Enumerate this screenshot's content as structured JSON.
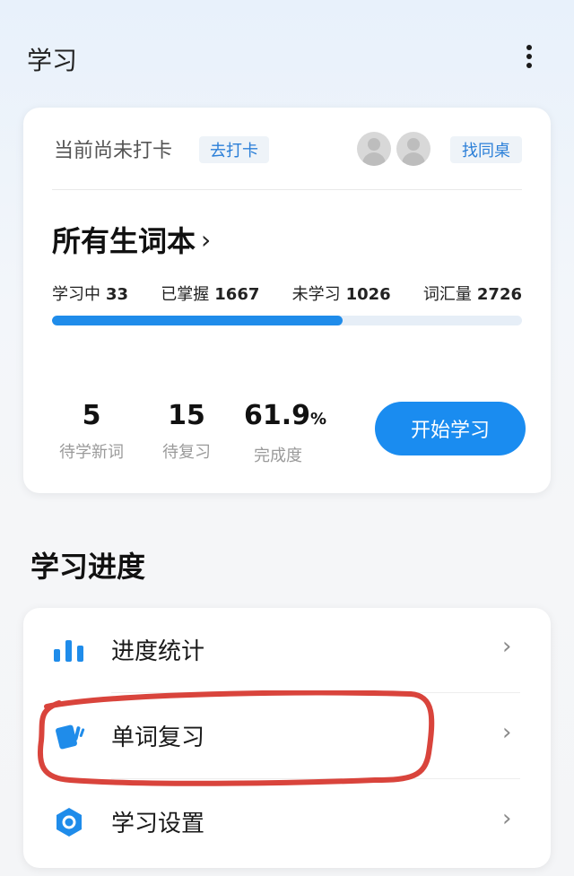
{
  "header": {
    "title": "学习",
    "more_icon": "more-vertical-icon"
  },
  "study_card": {
    "checkin_status": "当前尚未打卡",
    "checkin_button": "去打卡",
    "find_deskmate_button": "找同桌",
    "book_title": "所有生词本",
    "book_chevron": "›",
    "stats": [
      {
        "label": "学习中",
        "value": "33"
      },
      {
        "label": "已掌握",
        "value": "1667"
      },
      {
        "label": "未学习",
        "value": "1026"
      },
      {
        "label": "词汇量",
        "value": "2726"
      }
    ],
    "progress_fraction": 0.619,
    "metrics": [
      {
        "value": "5",
        "label": "待学新词"
      },
      {
        "value": "15",
        "label": "待复习"
      },
      {
        "value": "61.9",
        "unit": "%",
        "label": "完成度"
      }
    ],
    "start_button": "开始学习",
    "accent_color": "#1a8cf0"
  },
  "progress_section": {
    "title": "学习进度",
    "items": [
      {
        "label": "进度统计",
        "icon": "bar-chart-icon",
        "chevron": "›"
      },
      {
        "label": "单词复习",
        "icon": "flashcards-icon",
        "chevron": "›"
      },
      {
        "label": "学习设置",
        "icon": "hexagon-settings-icon",
        "chevron": "›"
      }
    ]
  },
  "annotation_color": "#d9443c"
}
